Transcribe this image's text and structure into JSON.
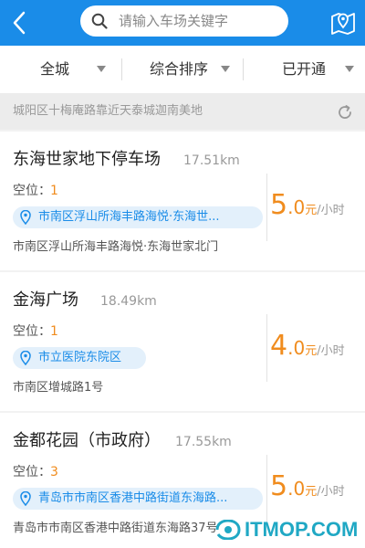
{
  "search": {
    "placeholder": "请输入车场关键字"
  },
  "filters": [
    {
      "label": "全城"
    },
    {
      "label": "综合排序"
    },
    {
      "label": "已开通"
    }
  ],
  "location": {
    "text": "城阳区十梅庵路靠近天泰城迦南美地"
  },
  "spaces_label": "空位：",
  "lots": [
    {
      "name": "东海世家地下停车场",
      "distance": "17.51km",
      "spaces": "1",
      "location_tag": "市南区浮山所海丰路海悦·东海世...",
      "address": "市南区浮山所海丰路海悦·东海世家北门",
      "price_int": "5",
      "price_dec": ".0",
      "price_unit": "元",
      "price_per": "/小时"
    },
    {
      "name": "金海广场",
      "distance": "18.49km",
      "spaces": "1",
      "location_tag": "市立医院东院区",
      "address": "市南区增城路1号",
      "price_int": "4",
      "price_dec": ".0",
      "price_unit": "元",
      "price_per": "/小时"
    },
    {
      "name": "金都花园（市政府）",
      "distance": "17.55km",
      "spaces": "3",
      "location_tag": "青岛市市南区香港中路街道东海路...",
      "address": "青岛市市南区香港中路街道东海路37号",
      "price_int": "5",
      "price_dec": ".0",
      "price_unit": "元",
      "price_per": "/小时"
    }
  ],
  "watermark": {
    "text": "ITMOP.COM"
  },
  "colors": {
    "primary": "#1a8ce8",
    "accent": "#f08c1e",
    "tag_bg": "#e3f0fb"
  }
}
